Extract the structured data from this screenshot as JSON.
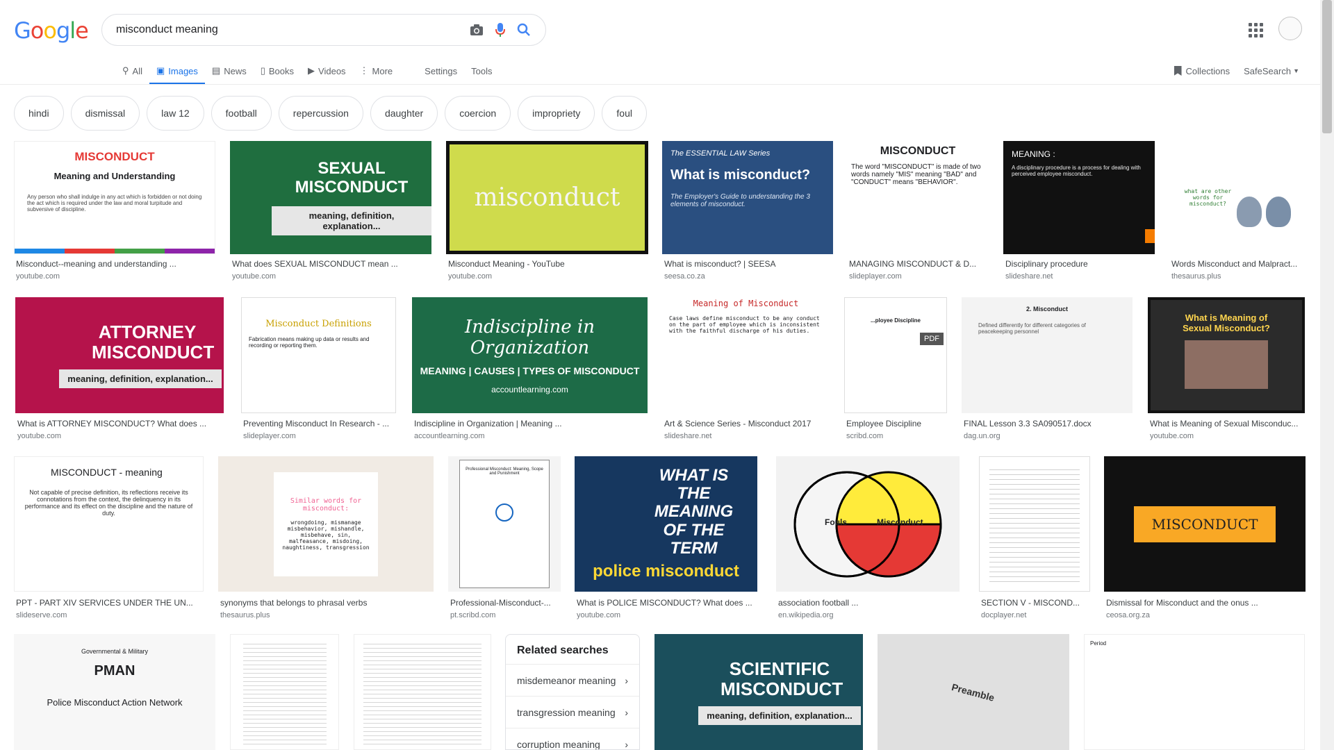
{
  "logo": [
    "G",
    "o",
    "o",
    "g",
    "l",
    "e"
  ],
  "search": {
    "query": "misconduct meaning"
  },
  "tabs": [
    {
      "label": "All",
      "icon": "search-icon"
    },
    {
      "label": "Images",
      "icon": "image-icon",
      "active": true
    },
    {
      "label": "News",
      "icon": "news-icon"
    },
    {
      "label": "Books",
      "icon": "book-icon"
    },
    {
      "label": "Videos",
      "icon": "video-icon"
    },
    {
      "label": "More",
      "icon": "more-vert-icon"
    }
  ],
  "tools": {
    "settings": "Settings",
    "tools": "Tools",
    "collections": "Collections",
    "safesearch": "SafeSearch"
  },
  "chips": [
    "hindi",
    "dismissal",
    "law 12",
    "football",
    "repercussion",
    "daughter",
    "coercion",
    "impropriety",
    "foul"
  ],
  "results": [
    {
      "caption": "Misconduct--meaning and understanding ...",
      "source": "youtube.com",
      "thumb_text": "MISCONDUCT",
      "thumb_sub": "Meaning and Understanding",
      "thumb_body": "Any person who shall indulge in any act which is forbidden or not doing the act which is required under the law and moral turpitude and subversive of discipline."
    },
    {
      "caption": "What does SEXUAL MISCONDUCT mean ...",
      "source": "youtube.com",
      "thumb_text": "SEXUAL MISCONDUCT",
      "thumb_sub": "meaning, definition, explanation..."
    },
    {
      "caption": "Misconduct Meaning - YouTube",
      "source": "youtube.com",
      "thumb_text": "misconduct"
    },
    {
      "caption": "What is misconduct? | SEESA",
      "source": "seesa.co.za",
      "thumb_text": "What is misconduct?",
      "thumb_sub": "The ESSENTIAL LAW Series",
      "thumb_body": "The Employer's Guide to understanding the 3 elements of misconduct."
    },
    {
      "caption": "MANAGING MISCONDUCT & D...",
      "source": "slideplayer.com",
      "thumb_text": "MISCONDUCT",
      "thumb_body": "The word \"MISCONDUCT\" is made of two words namely \"MIS\" meaning \"BAD\" and \"CONDUCT\" means \"BEHAVIOR\"."
    },
    {
      "caption": "Disciplinary procedure",
      "source": "slideshare.net",
      "thumb_text": "MEANING :",
      "thumb_body": "A disciplinary procedure is a process for dealing with perceived employee misconduct."
    },
    {
      "caption": "Words Misconduct and Malpract...",
      "source": "thesaurus.plus",
      "thumb_text": "what are other words for misconduct?"
    },
    {
      "caption": "What is ATTORNEY MISCONDUCT? What does ...",
      "source": "youtube.com",
      "thumb_text": "ATTORNEY MISCONDUCT",
      "thumb_sub": "meaning, definition, explanation..."
    },
    {
      "caption": "Preventing Misconduct In Research - ...",
      "source": "slideplayer.com",
      "thumb_text": "Misconduct Definitions",
      "thumb_body": "Fabrication means making up data or results and recording or reporting them."
    },
    {
      "caption": "Indiscipline in Organization | Meaning ...",
      "source": "accountlearning.com",
      "thumb_text": "Indiscipline in Organization",
      "thumb_sub": "MEANING | CAUSES | TYPES OF MISCONDUCT",
      "thumb_body": "accountlearning.com"
    },
    {
      "caption": "Art & Science Series - Misconduct 2017",
      "source": "slideshare.net",
      "thumb_text": "Meaning of Misconduct",
      "thumb_body": "Case laws define misconduct to be any conduct on the part of employee which is inconsistent with the faithful discharge of his duties."
    },
    {
      "caption": "Employee Discipline",
      "source": "scribd.com",
      "thumb_text": "...ployee Discipline",
      "thumb_sub": "PDF"
    },
    {
      "caption": "FINAL Lesson 3.3 SA090517.docx",
      "source": "dag.un.org",
      "thumb_text": "2. Misconduct",
      "thumb_body": "Defined differently for different categories of peacekeeping personnel"
    },
    {
      "caption": "What is Meaning of Sexual Misconduc...",
      "source": "youtube.com",
      "thumb_text": "What is Meaning of Sexual Misconduct?"
    },
    {
      "caption": "PPT - PART XIV SERVICES UNDER THE UN...",
      "source": "slideserve.com",
      "thumb_text": "MISCONDUCT - meaning",
      "thumb_body": "Not capable of precise definition, its reflections receive its connotations from the context, the delinquency in its performance and its effect on the discipline and the nature of duty."
    },
    {
      "caption": "synonyms that belongs to phrasal verbs",
      "source": "thesaurus.plus",
      "thumb_text": "Similar words for misconduct:",
      "thumb_body": "wrongdoing, mismanage misbehavior, mishandle, misbehave, sin, malfeasance, misdoing, naughtiness, transgression"
    },
    {
      "caption": "Professional-Misconduct-...",
      "source": "pt.scribd.com",
      "thumb_text": "Professional Misconduct: Meaning, Scope and Punishment"
    },
    {
      "caption": "What is POLICE MISCONDUCT? What does ...",
      "source": "youtube.com",
      "thumb_text": "WHAT IS THE MEANING OF THE TERM",
      "thumb_sub": "police misconduct"
    },
    {
      "caption": "association football ...",
      "source": "en.wikipedia.org",
      "thumb_text": "Fouls",
      "thumb_sub": "Misconduct"
    },
    {
      "caption": "SECTION V - MISCOND...",
      "source": "docplayer.net",
      "thumb_text": ""
    },
    {
      "caption": "Dismissal for Misconduct and the onus ...",
      "source": "ceosa.org.za",
      "thumb_text": "MISCONDUCT"
    },
    {
      "caption": "",
      "source": "",
      "thumb_text": "PMAN",
      "thumb_sub": "Police Misconduct Action Network",
      "thumb_body": "Governmental & Military"
    },
    {
      "caption": "",
      "source": "",
      "thumb_text": ""
    },
    {
      "caption": "",
      "source": "",
      "thumb_text": ""
    },
    {
      "caption": "",
      "source": "",
      "thumb_text": "SCIENTIFIC MISCONDUCT",
      "thumb_sub": "meaning, definition, explanation..."
    },
    {
      "caption": "",
      "source": "",
      "thumb_text": "Preamble"
    },
    {
      "caption": "",
      "source": "",
      "thumb_text": "Period"
    }
  ],
  "related": {
    "title": "Related searches",
    "items": [
      "misdemeanor meaning",
      "transgression meaning",
      "corruption meaning"
    ]
  }
}
